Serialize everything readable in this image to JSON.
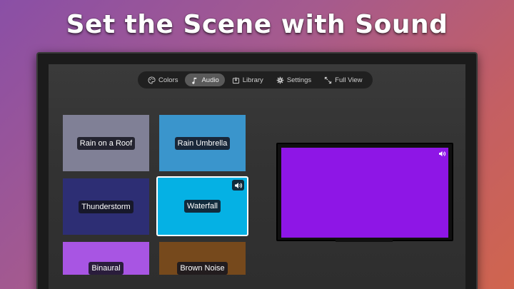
{
  "headline": "Set the Scene with Sound",
  "tabs": [
    {
      "label": "Colors",
      "icon": "palette-icon",
      "active": false
    },
    {
      "label": "Audio",
      "icon": "music-note-icon",
      "active": true
    },
    {
      "label": "Library",
      "icon": "library-icon",
      "active": false
    },
    {
      "label": "Settings",
      "icon": "gear-icon",
      "active": false
    },
    {
      "label": "Full View",
      "icon": "expand-icon",
      "active": false
    }
  ],
  "sounds": [
    {
      "label": "Rain on a Roof",
      "color": "#808096"
    },
    {
      "label": "Rain Umbrella",
      "color": "#3a95cc"
    },
    {
      "label": "Thunderstorm",
      "color": "#2d2e74"
    },
    {
      "label": "Waterfall",
      "color": "#05b1e4",
      "selected": true,
      "icon": "speaker-icon"
    },
    {
      "label": "Binaural",
      "color": "#a855e3"
    },
    {
      "label": "Brown Noise",
      "color": "#76491c"
    }
  ],
  "preview": {
    "color": "#8e16e6",
    "icon": "speaker-icon"
  }
}
